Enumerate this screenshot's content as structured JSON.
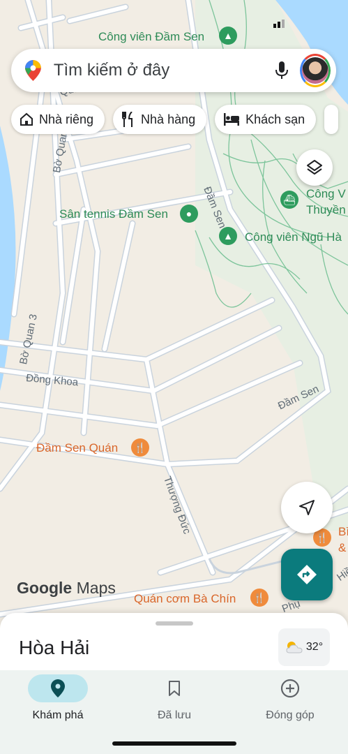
{
  "map": {
    "labels": {
      "cong_vien_dam_sen": "Công viên Đầm Sen",
      "san_tennis": "Sân tennis Đầm Sen",
      "cong_vien_ngu_ha": "Công viên Ngũ Hà",
      "cong_v_thuyen_1": "Công V",
      "cong_v_thuyen_2": "Thuyền",
      "dam_sen_road_1": "Đầm Sen",
      "dam_sen_road_2": "Đầm Sen",
      "bo_quan_3_a": "Bờ Quan 3",
      "bo_quan_3_b": "Bờ Quan",
      "quan_top": "Quan",
      "dong_khoa": "Đồng Khoa",
      "dam_sen_quan": "Đầm Sen Quán",
      "thuong_duc": "Thượng Đức",
      "quan_com_ba_chin": "Quán cơm Bà Chín",
      "ph_label": "Phụ",
      "hie_label": "Hiề",
      "b_label": "Bì",
      "amp_label": "&"
    },
    "colors": {
      "land": "#f2ede4",
      "road": "#ffffff",
      "road_edge": "#c9d3dd",
      "water": "#aadaff",
      "park_path": "#7cc49a",
      "green_label": "#2e8b57",
      "orange_label": "#d9662a"
    }
  },
  "search": {
    "placeholder": "Tìm kiếm ở đây",
    "icon": "maps-pin-icon",
    "mic_icon": "mic-icon",
    "avatar_icon": "avatar"
  },
  "chips": [
    {
      "label": "Nhà riêng",
      "icon": "home-icon"
    },
    {
      "label": "Nhà hàng",
      "icon": "restaurant-icon"
    },
    {
      "label": "Khách sạn",
      "icon": "hotel-icon"
    }
  ],
  "logo": {
    "google": "Google",
    "maps": "Maps"
  },
  "sheet": {
    "place_name": "Hòa Hải",
    "weather_temp": "32°",
    "weather_icon": "partly-cloudy-icon"
  },
  "nav": [
    {
      "label": "Khám phá",
      "icon": "explore-pin-icon",
      "active": true
    },
    {
      "label": "Đã lưu",
      "icon": "bookmark-icon",
      "active": false
    },
    {
      "label": "Đóng góp",
      "icon": "add-circle-icon",
      "active": false
    }
  ],
  "accent_color": "#0b7b7d"
}
